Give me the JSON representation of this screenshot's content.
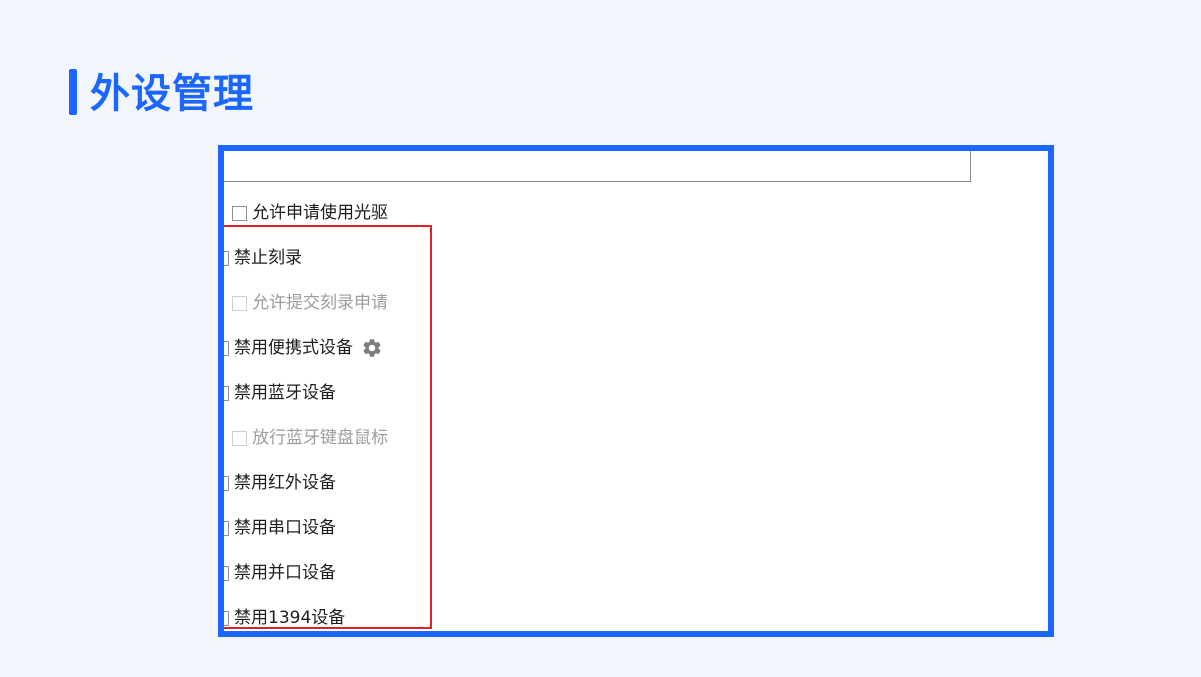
{
  "page_title": "外设管理",
  "accent_color": "#1a66ff",
  "highlight_color": "#e0202a",
  "options": [
    {
      "label": "允许申请使用光驱",
      "checked": false,
      "disabled": false
    },
    {
      "label": "禁止刻录",
      "checked": false,
      "disabled": false
    },
    {
      "label": "允许提交刻录申请",
      "checked": false,
      "disabled": true
    },
    {
      "label": "禁用便携式设备",
      "checked": false,
      "disabled": false,
      "icon": "gear-icon"
    },
    {
      "label": "禁用蓝牙设备",
      "checked": false,
      "disabled": false
    },
    {
      "label": "放行蓝牙键盘鼠标",
      "checked": false,
      "disabled": true
    },
    {
      "label": "禁用红外设备",
      "checked": false,
      "disabled": false
    },
    {
      "label": "禁用串口设备",
      "checked": false,
      "disabled": false
    },
    {
      "label": "禁用并口设备",
      "checked": false,
      "disabled": false
    },
    {
      "label": "禁用1394设备",
      "checked": false,
      "disabled": false
    }
  ]
}
